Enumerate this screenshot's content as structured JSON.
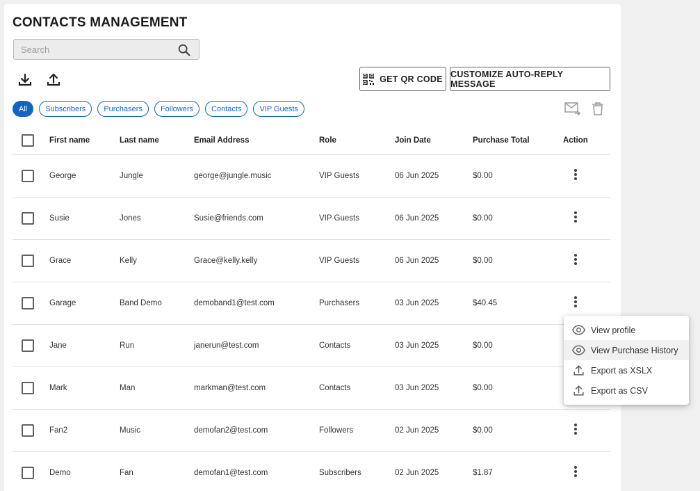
{
  "page": {
    "title": "CONTACTS MANAGEMENT"
  },
  "search": {
    "placeholder": "Search"
  },
  "toolbar": {
    "qr_label": "GET QR CODE",
    "autoreply_label": "CUSTOMIZE AUTO-REPLY MESSAGE"
  },
  "filters": [
    "All",
    "Subscribers",
    "Purchasers",
    "Followers",
    "Contacts",
    "VIP Guests"
  ],
  "filter_active": "All",
  "table": {
    "headers": {
      "first": "First name",
      "last": "Last name",
      "email": "Email Address",
      "role": "Role",
      "date": "Join Date",
      "total": "Purchase Total",
      "action": "Action"
    },
    "rows": [
      {
        "first": "George",
        "last": "Jungle",
        "email": "george@jungle.music",
        "role": "VIP Guests",
        "date": "06 Jun 2025",
        "total": "$0.00"
      },
      {
        "first": "Susie",
        "last": "Jones",
        "email": "Susie@friends.com",
        "role": "VIP Guests",
        "date": "06 Jun 2025",
        "total": "$0.00"
      },
      {
        "first": "Grace",
        "last": "Kelly",
        "email": "Grace@kelly.kelly",
        "role": "VIP Guests",
        "date": "06 Jun 2025",
        "total": "$0.00"
      },
      {
        "first": "Garage",
        "last": "Band Demo",
        "email": "demoband1@test.com",
        "role": "Purchasers",
        "date": "03 Jun 2025",
        "total": "$40.45"
      },
      {
        "first": "Jane",
        "last": "Run",
        "email": "janerun@test.com",
        "role": "Contacts",
        "date": "03 Jun 2025",
        "total": "$0.00"
      },
      {
        "first": "Mark",
        "last": "Man",
        "email": "markman@test.com",
        "role": "Contacts",
        "date": "03 Jun 2025",
        "total": "$0.00"
      },
      {
        "first": "Fan2",
        "last": "Music",
        "email": "demofan2@test.com",
        "role": "Followers",
        "date": "02 Jun 2025",
        "total": "$0.00"
      },
      {
        "first": "Demo",
        "last": "Fan",
        "email": "demofan1@test.com",
        "role": "Subscribers",
        "date": "02 Jun 2025",
        "total": "$1.87"
      }
    ]
  },
  "context_menu": {
    "items": [
      {
        "label": "View profile",
        "icon": "eye-icon"
      },
      {
        "label": "View Purchase History",
        "icon": "eye-icon"
      },
      {
        "label": "Export as XSLX",
        "icon": "upload-icon"
      },
      {
        "label": "Export as CSV",
        "icon": "upload-icon"
      }
    ],
    "highlighted_index": 1
  },
  "colors": {
    "accent": "#1565c0",
    "background": "#f0f0f0",
    "panel": "#ffffff"
  }
}
